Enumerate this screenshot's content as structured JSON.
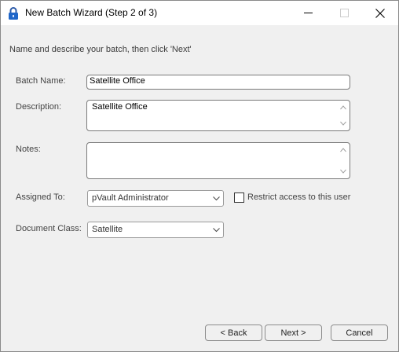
{
  "window": {
    "title": "New Batch Wizard (Step 2 of 3)",
    "icon": "padlock-icon",
    "controls": {
      "minimize": "minimize-icon",
      "maximize": "maximize-icon",
      "close": "close-icon"
    }
  },
  "instruction": "Name and describe your batch, then click 'Next'",
  "form": {
    "batch_name": {
      "label": "Batch Name:",
      "value": "Satellite Office"
    },
    "description": {
      "label": "Description:",
      "value": "Satellite Office"
    },
    "notes": {
      "label": "Notes:",
      "value": ""
    },
    "assigned_to": {
      "label": "Assigned To:",
      "value": "pVault  Administrator"
    },
    "restrict": {
      "label": "Restrict access to this user",
      "checked": false
    },
    "document_class": {
      "label": "Document Class:",
      "value": "Satellite"
    }
  },
  "buttons": {
    "back": "< Back",
    "next": "Next >",
    "cancel": "Cancel"
  }
}
